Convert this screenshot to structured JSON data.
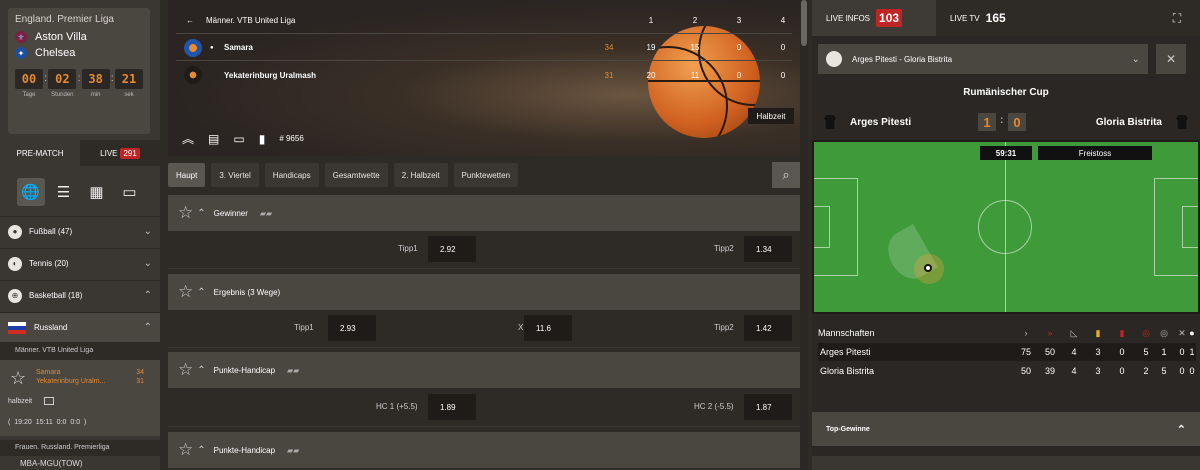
{
  "featured": {
    "league": "England. Premier Liga",
    "team1": "Aston Villa",
    "team2": "Chelsea",
    "countdown": [
      {
        "v": "00",
        "l": "Tage"
      },
      {
        "v": "02",
        "l": "Stunden"
      },
      {
        "v": "38",
        "l": "min"
      },
      {
        "v": "21",
        "l": "sek"
      }
    ]
  },
  "modes": {
    "prematch": "PRE-MATCH",
    "live": "LIVE",
    "live_count": "291"
  },
  "sports": [
    {
      "name": "Fußball (47)"
    },
    {
      "name": "Tennis (20)"
    },
    {
      "name": "Basketball (18)"
    }
  ],
  "country": "Russland",
  "league1": "Männer. VTB United Liga",
  "live_match": {
    "team1": "Samara",
    "team2": "Yekaterinburg Uralm...",
    "s1": "34",
    "s2": "31",
    "status": "halbzeit",
    "line": "( 19:20 15:11 0:0 0:0 )"
  },
  "league2": "Frauen. Russland. Premierliga",
  "cut_team": "MBA-MGU(TOW)",
  "scoreboard": {
    "league": "Männer. VTB United Liga",
    "periods": [
      "1",
      "2",
      "3",
      "4"
    ],
    "teams": [
      {
        "name": "Samara",
        "total": "34",
        "q": [
          "19",
          "15",
          "0",
          "0"
        ]
      },
      {
        "name": "Yekaterinburg Uralmash",
        "total": "31",
        "q": [
          "20",
          "11",
          "0",
          "0"
        ]
      }
    ],
    "status": "Halbzeit",
    "id": "# 9656"
  },
  "tabs": [
    "Haupt",
    "3. Viertel",
    "Handicaps",
    "Gesamtwette",
    "2. Halbzeit",
    "Punktewetten"
  ],
  "markets": [
    {
      "title": "Gewinner",
      "odds": [
        {
          "l": "Tipp1",
          "v": "2.92"
        },
        {
          "l": "Tipp2",
          "v": "1.34"
        }
      ]
    },
    {
      "title": "Ergebnis (3 Wege)",
      "odds": [
        {
          "l": "Tipp1",
          "v": "2.93"
        },
        {
          "l": "X",
          "v": "11.6"
        },
        {
          "l": "Tipp2",
          "v": "1.42"
        }
      ]
    },
    {
      "title": "Punkte-Handicap",
      "odds": [
        {
          "l": "HC 1  (+5.5)",
          "v": "1.89"
        },
        {
          "l": "HC 2  (-5.5)",
          "v": "1.87"
        }
      ]
    },
    {
      "title": "Punkte-Handicap",
      "odds": []
    }
  ],
  "right": {
    "live_infos": "LIVE INFOS",
    "live_infos_count": "103",
    "live_tv": "LIVE TV",
    "live_tv_count": "165",
    "selected_match": "Arges Pitesti - Gloria Bistrita",
    "cup": "Rumänischer Cup",
    "home": "Arges Pitesti",
    "away": "Gloria Bistrita",
    "home_score": "1",
    "away_score": "0",
    "clock": "59:31",
    "event": "Freistoss",
    "stats_header": "Mannschaften",
    "stats": [
      {
        "team": "Arges Pitesti",
        "v": [
          "75",
          "50",
          "4",
          "3",
          "0",
          "5",
          "1",
          "0",
          "1"
        ]
      },
      {
        "team": "Gloria Bistrita",
        "v": [
          "50",
          "39",
          "4",
          "3",
          "0",
          "2",
          "5",
          "0",
          "0"
        ]
      }
    ],
    "top_wins": "Top-Gewinne"
  },
  "colors": {
    "accent": "#e58a2e",
    "live_red": "#c02424",
    "pitch": "#3f9a39"
  }
}
